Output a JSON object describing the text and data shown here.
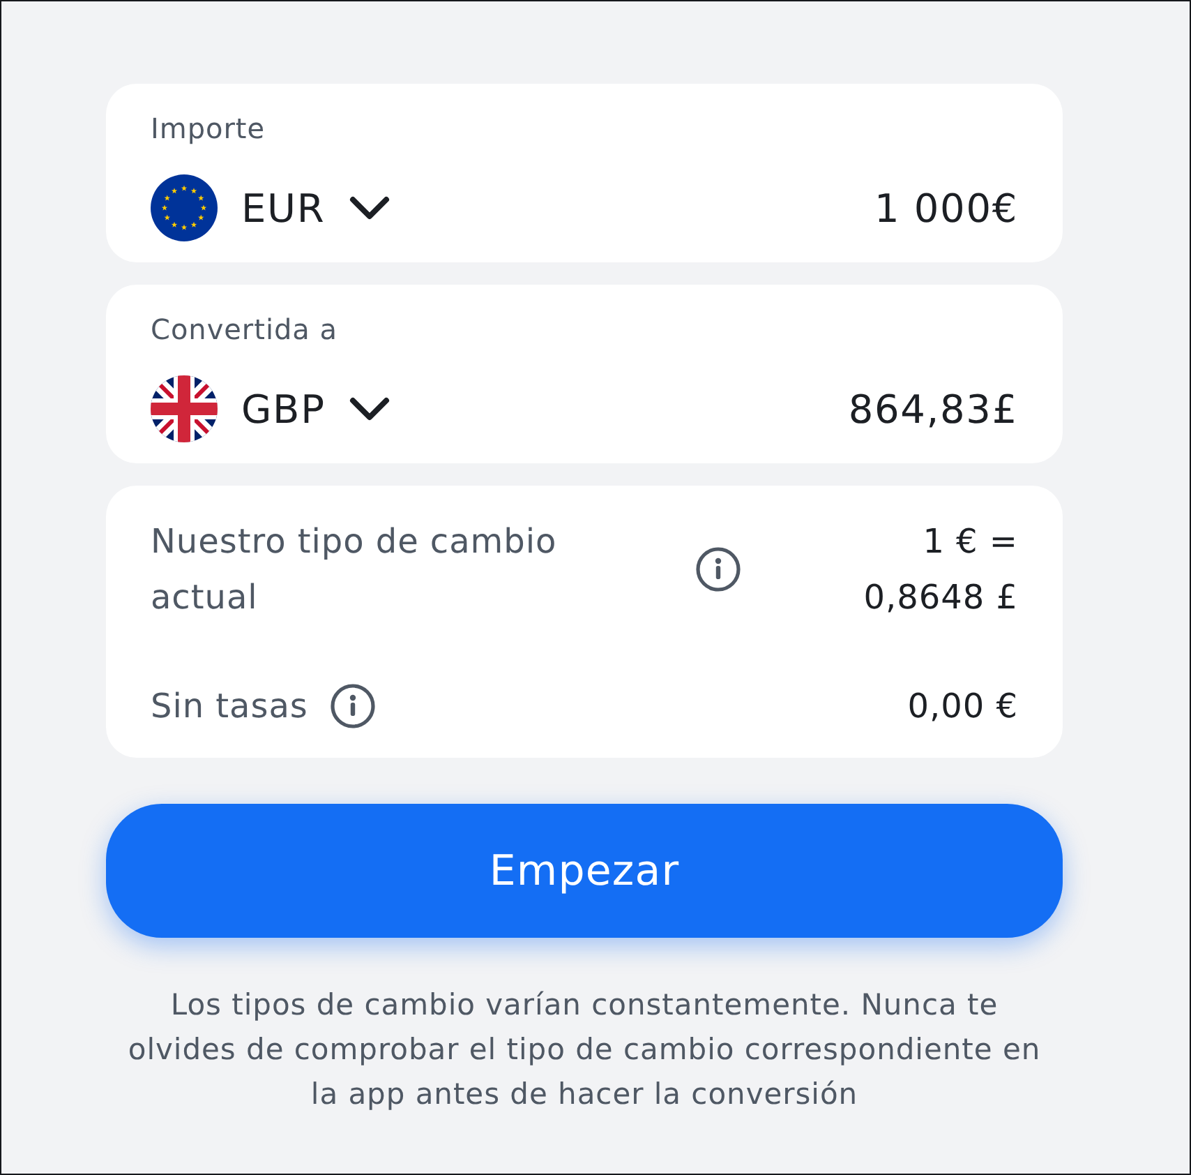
{
  "currency_cards": [
    {
      "label": "Importe",
      "currency": "EUR",
      "value": "1 000€"
    },
    {
      "label": "Convertida a",
      "currency": "GBP",
      "value": "864,83£"
    }
  ],
  "details": [
    {
      "label": "Nuestro tipo de cambio actual",
      "value": "1 € = 0,8648 £"
    },
    {
      "label": "Sin tasas",
      "value": "0,00 €"
    }
  ],
  "primary_button": "Empezar",
  "disclaimer": "Los tipos de cambio varían constantemente. Nunca te olvides de comprobar el tipo de cambio correspondiente en la app antes de hacer la conversión"
}
